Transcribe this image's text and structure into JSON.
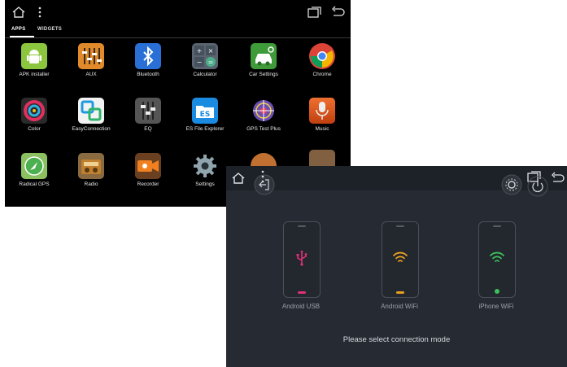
{
  "drawer": {
    "tabs": [
      {
        "label": "APPS"
      },
      {
        "label": "WIDGETS"
      }
    ],
    "apps": [
      {
        "label": "APK installer",
        "icon": "android-icon",
        "color": "#8cc63f"
      },
      {
        "label": "AUX",
        "icon": "aux-sliders-icon",
        "color": "#e08a2c"
      },
      {
        "label": "Bluetooth",
        "icon": "bluetooth-icon",
        "color": "#2a6fd6"
      },
      {
        "label": "Calculator",
        "icon": "calculator-icon",
        "color": "#5a6470"
      },
      {
        "label": "Car Settings",
        "icon": "car-settings-icon",
        "color": "#3f9a3a"
      },
      {
        "label": "Chrome",
        "icon": "chrome-icon",
        "color": "#db4437"
      },
      {
        "label": "Color",
        "icon": "color-icon",
        "color": "#333333"
      },
      {
        "label": "EasyConnection",
        "icon": "easyconnection-icon",
        "color": "#1e9be0"
      },
      {
        "label": "EQ",
        "icon": "eq-icon",
        "color": "#555555"
      },
      {
        "label": "ES File Explorer",
        "icon": "es-file-explorer-icon",
        "color": "#1a8be0"
      },
      {
        "label": "GPS Test Plus",
        "icon": "gps-test-icon",
        "color": "#7a5bb5"
      },
      {
        "label": "Music",
        "icon": "music-icon",
        "color": "#e06020"
      },
      {
        "label": "Radical GPS",
        "icon": "radical-gps-icon",
        "color": "#4caf50"
      },
      {
        "label": "Radio",
        "icon": "radio-icon",
        "color": "#c08030"
      },
      {
        "label": "Recorder",
        "icon": "recorder-icon",
        "color": "#e07a20"
      },
      {
        "label": "Settings",
        "icon": "gear-icon",
        "color": "#607d8b"
      }
    ]
  },
  "connection": {
    "modes": [
      {
        "label": "Android USB",
        "icon": "usb-icon",
        "accent": "#e0307a"
      },
      {
        "label": "Android WiFi",
        "icon": "wifi-icon",
        "accent": "#e8a020"
      },
      {
        "label": "iPhone WiFi",
        "icon": "wifi-icon",
        "accent": "#3cc05a"
      }
    ],
    "prompt": "Please select connection mode"
  }
}
